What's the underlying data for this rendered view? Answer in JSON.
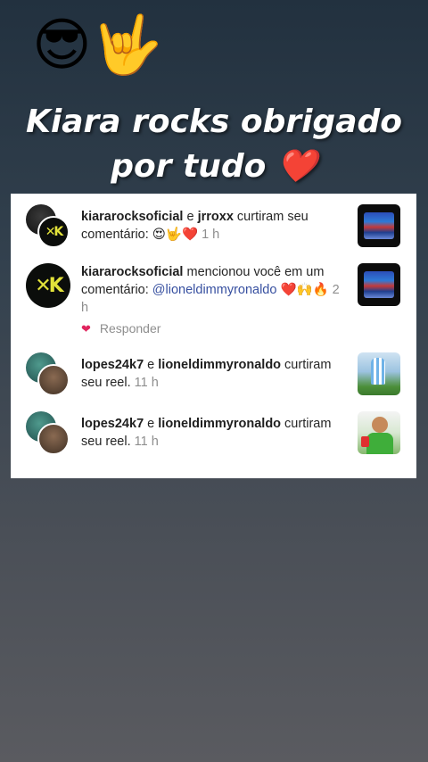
{
  "header": {
    "emojis": "😎🤟",
    "headline_line1": "Kiara rocks obrigado",
    "headline_line2": "por tudo ❤️"
  },
  "notifications": [
    {
      "user1": "kiararocksoficial",
      "connector": " e ",
      "user2": "jrroxx",
      "action": " curtiram seu comentário: ",
      "emojis": "😍🤟❤️",
      "time": "1 h",
      "thumbnail": "post-image",
      "avatar_icon": "kr-logo-avatar"
    },
    {
      "user1": "kiararocksoficial",
      "action": " mencionou você em um comentário: ",
      "mention": "@lioneldimmyronaldo",
      "emojis": " ❤️🙌🔥",
      "time": "2 h",
      "reply_icon": "heart-icon",
      "reply_label": "Responder",
      "thumbnail": "post-image",
      "avatar_icon": "kr-logo-avatar"
    },
    {
      "user1": "lopes24k7",
      "connector": " e ",
      "user2": "lioneldimmyronaldo",
      "action": " curtiram seu reel.",
      "time": "11 h",
      "thumbnail": "reel-image",
      "avatar_icon": "user-avatar"
    },
    {
      "user1": "lopes24k7",
      "connector": " e ",
      "user2": "lioneldimmyronaldo",
      "action": " curtiram seu reel.",
      "time": "11 h",
      "thumbnail": "reel-image",
      "avatar_icon": "user-avatar"
    }
  ],
  "colors": {
    "mention": "#3750a0",
    "reply_heart": "#e0245e",
    "timestamp": "#8e8e8e",
    "card_background": "#ffffff"
  }
}
